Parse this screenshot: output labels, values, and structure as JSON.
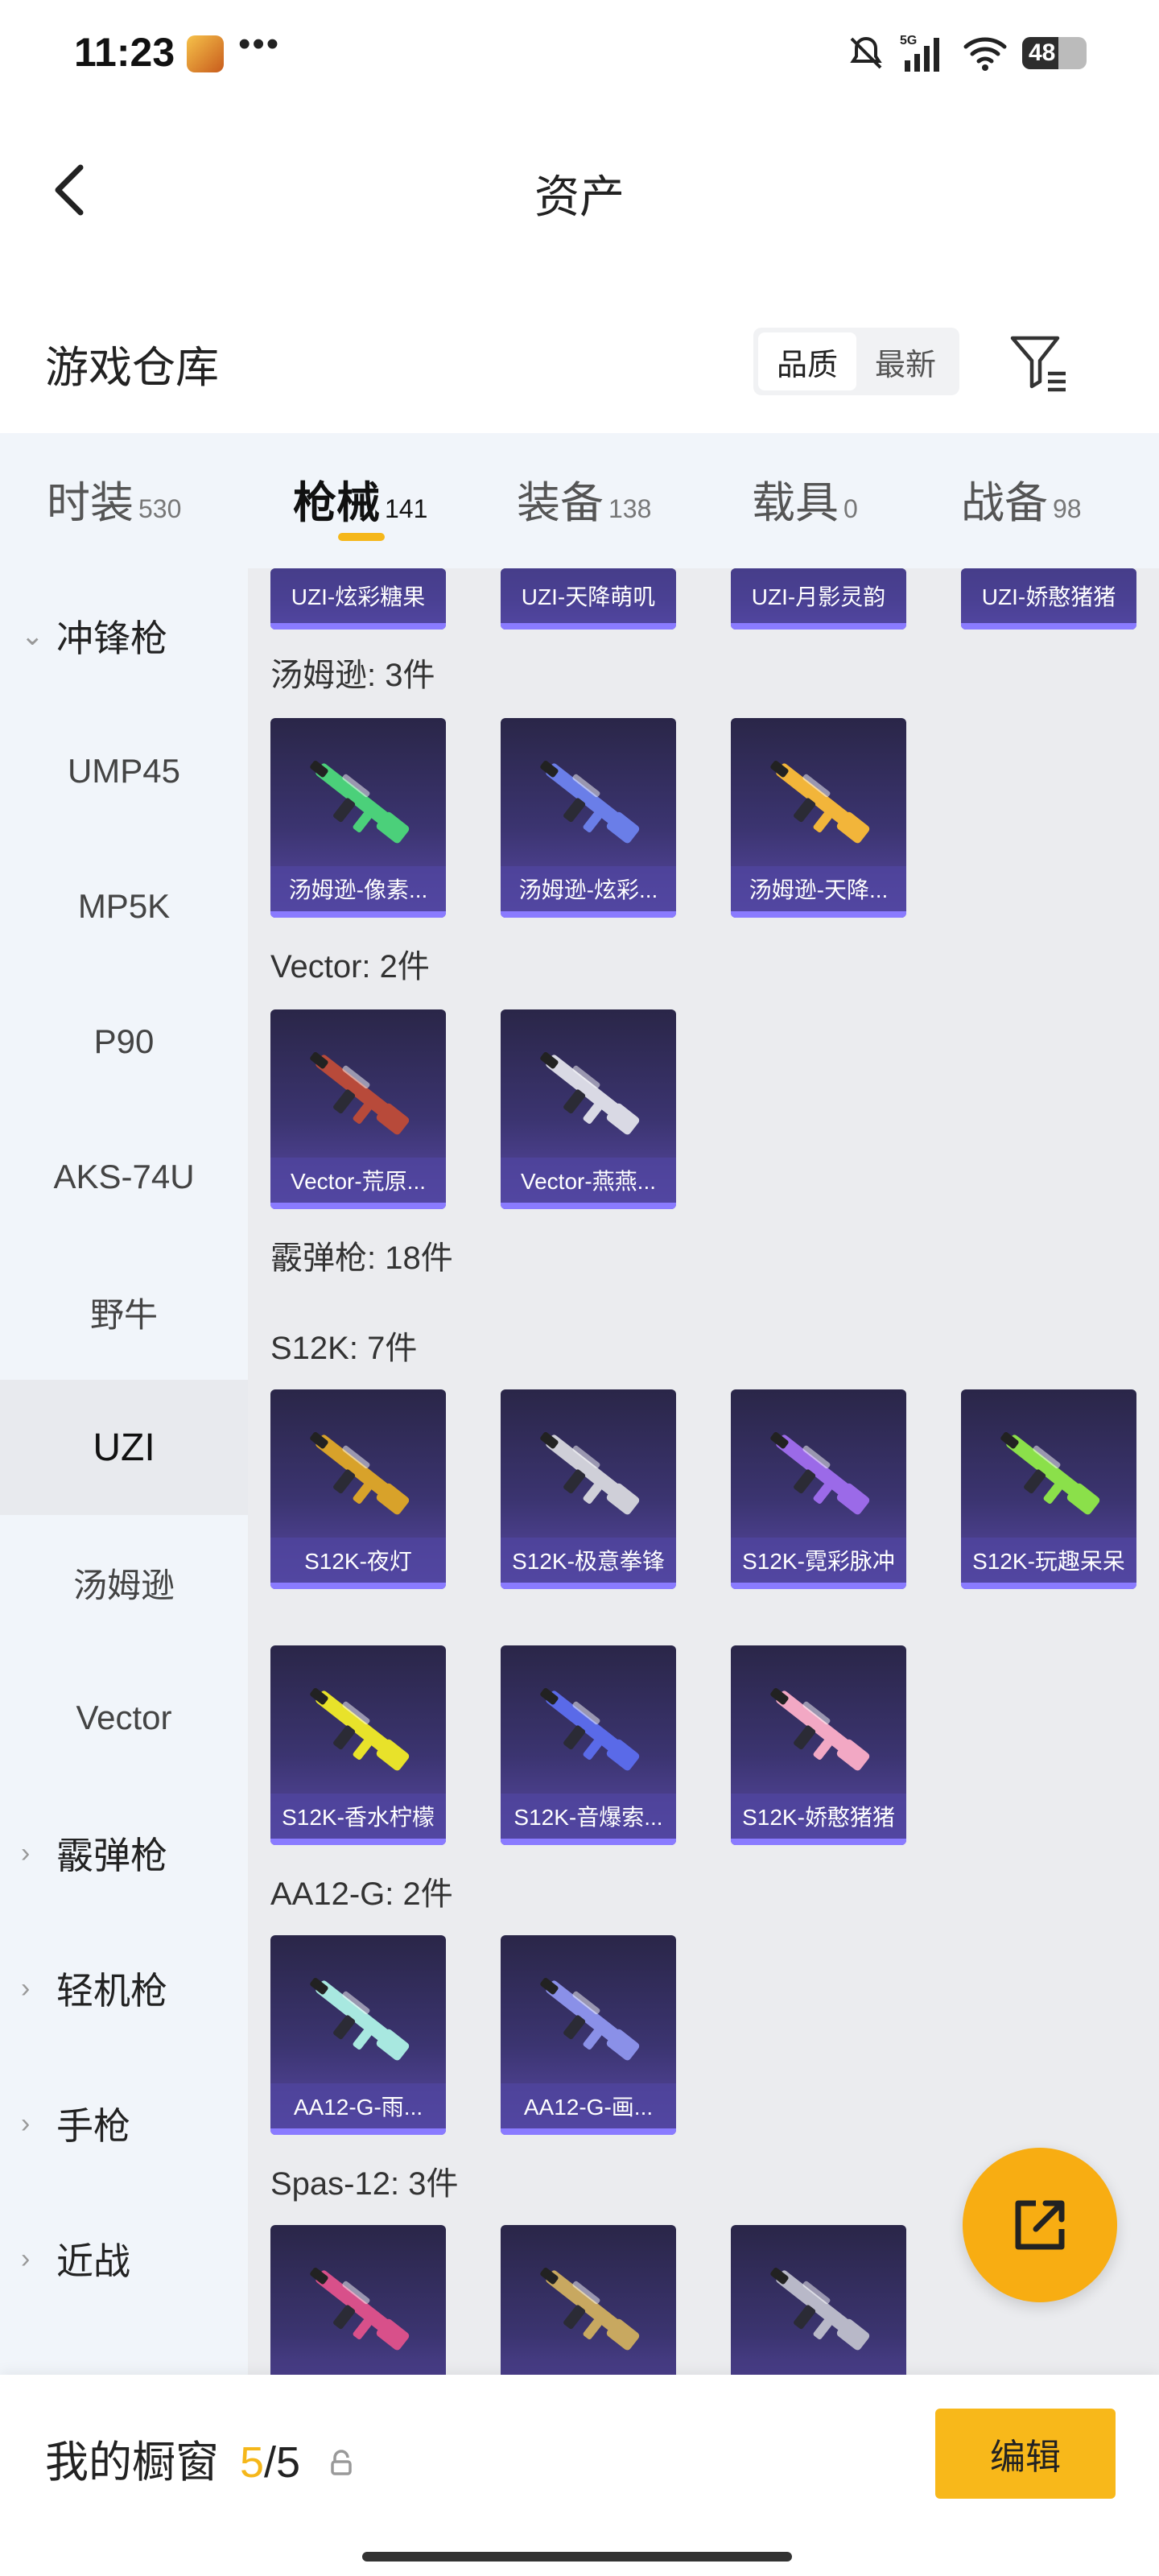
{
  "status_bar": {
    "time": "11:23",
    "dots": "•••",
    "network": "5G",
    "battery": "48",
    "icons": [
      "app-icon",
      "mute-icon",
      "signal-icon",
      "wifi-icon",
      "battery-icon"
    ]
  },
  "header": {
    "title": "资产",
    "back_icon": "back-icon"
  },
  "warehouse": {
    "title": "游戏仓库",
    "sort_options": [
      "品质",
      "最新"
    ],
    "active_sort": "品质",
    "filter_icon": "filter-icon"
  },
  "tabs": [
    {
      "label": "时装",
      "count": "530"
    },
    {
      "label": "枪械",
      "count": "141"
    },
    {
      "label": "装备",
      "count": "138"
    },
    {
      "label": "载具",
      "count": "0"
    },
    {
      "label": "战备",
      "count": "98"
    }
  ],
  "active_tab": "枪械",
  "sidebar": {
    "items": [
      {
        "label": "冲锋枪",
        "type": "group",
        "expanded": true
      },
      {
        "label": "UMP45",
        "type": "sub"
      },
      {
        "label": "MP5K",
        "type": "sub"
      },
      {
        "label": "P90",
        "type": "sub"
      },
      {
        "label": "AKS-74U",
        "type": "sub"
      },
      {
        "label": "野牛",
        "type": "sub"
      },
      {
        "label": "UZI",
        "type": "sub",
        "active": true
      },
      {
        "label": "汤姆逊",
        "type": "sub"
      },
      {
        "label": "Vector",
        "type": "sub"
      },
      {
        "label": "霰弹枪",
        "type": "group",
        "expanded": false
      },
      {
        "label": "轻机枪",
        "type": "group",
        "expanded": false
      },
      {
        "label": "手枪",
        "type": "group",
        "expanded": false
      },
      {
        "label": "近战",
        "type": "group",
        "expanded": false
      }
    ]
  },
  "content": {
    "uzi_partial": [
      "UZI-炫彩糖果",
      "UZI-天降萌叽",
      "UZI-月影灵韵",
      "UZI-娇憨猪猪"
    ],
    "groups": [
      {
        "label": "汤姆逊: 3件",
        "items": [
          "汤姆逊-像素...",
          "汤姆逊-炫彩...",
          "汤姆逊-天降..."
        ]
      },
      {
        "label": "Vector: 2件",
        "items": [
          "Vector-荒原...",
          "Vector-燕燕..."
        ]
      },
      {
        "label": "霰弹枪: 18件",
        "items": []
      },
      {
        "label": "S12K: 7件",
        "items": [
          "S12K-夜灯",
          "S12K-极意拳锋",
          "S12K-霓彩脉冲",
          "S12K-玩趣呆呆",
          "S12K-香水柠檬",
          "S12K-音爆索...",
          "S12K-娇憨猪猪"
        ]
      },
      {
        "label": "AA12-G: 2件",
        "items": [
          "AA12-G-雨...",
          "AA12-G-画..."
        ]
      },
      {
        "label": "Spas-12: 3件",
        "items": [
          "",
          "",
          ""
        ]
      }
    ],
    "gun_colors": {
      "tommy1": "#4bd07a",
      "tommy2": "#6a7ee8",
      "tommy3": "#f2b53a",
      "vector1": "#b84a3a",
      "vector2": "#d9d9e4",
      "s12k1": "#d8a22a",
      "s12k2": "#cfcfd8",
      "s12k3": "#9b6ae8",
      "s12k4": "#8be04a",
      "s12k5": "#e8e22a",
      "s12k6": "#5a6ae8",
      "s12k7": "#f2a8c4",
      "aa1": "#a8e8e0",
      "aa2": "#8a90e8",
      "spas1": "#d8508a",
      "spas2": "#c8a860",
      "spas3": "#b8b8c8"
    }
  },
  "fab_icon": "share-icon",
  "bottom_bar": {
    "label": "我的橱窗",
    "used": "5",
    "total": "/5",
    "lock_icon": "lock-icon",
    "edit_label": "编辑"
  }
}
